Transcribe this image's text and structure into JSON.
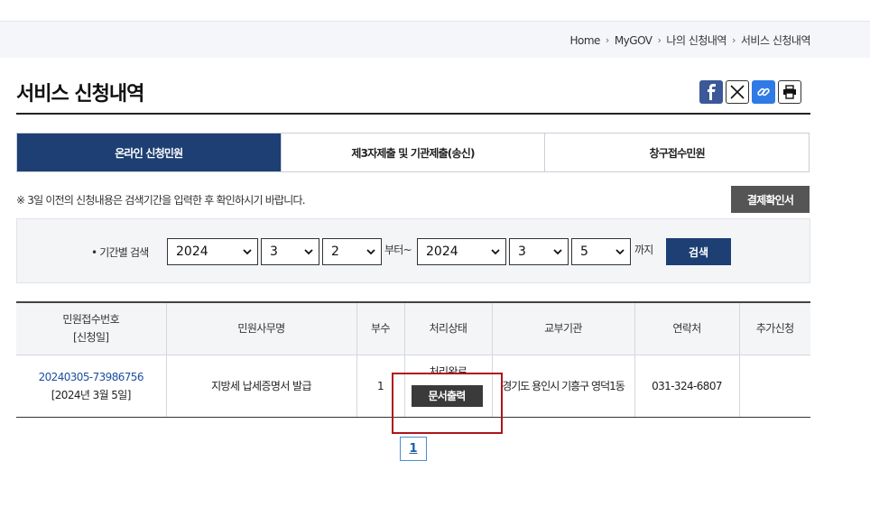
{
  "breadcrumb": {
    "items": [
      "Home",
      "MyGOV",
      "나의 신청내역",
      "서비스 신청내역"
    ]
  },
  "page": {
    "title": "서비스 신청내역"
  },
  "share": {
    "icons": [
      "facebook-icon",
      "x-icon",
      "link-icon",
      "print-icon"
    ],
    "colors": {
      "facebook": "#3b5998",
      "link": "#2f7ae5"
    }
  },
  "tabs": [
    {
      "label": "온라인 신청민원",
      "active": true
    },
    {
      "label": "제3자제출 및 기관제출(송신)",
      "active": false
    },
    {
      "label": "창구접수민원",
      "active": false
    }
  ],
  "notice": "※ 3일 이전의 신청내용은 검색기간을 입력한 후 확인하시기 바랍니다.",
  "receipt_button": "결제확인서",
  "search": {
    "label": "• 기간별 검색",
    "from_year": "2024",
    "from_month": "3",
    "from_day": "2",
    "from_suffix": "부터~",
    "to_year": "2024",
    "to_month": "3",
    "to_day": "5",
    "to_suffix": "까지",
    "button": "검색"
  },
  "table": {
    "headers": {
      "receipt_no": "민원접수번호",
      "receipt_date": "[신청일]",
      "service": "민원사무명",
      "copies": "부수",
      "status": "처리상태",
      "agency": "교부기관",
      "contact": "연락처",
      "extra": "추가신청"
    },
    "rows": [
      {
        "receipt_no": "20240305-73986756",
        "date": "[2024년 3월 5일]",
        "service": "지방세 납세증명서 발급",
        "copies": "1",
        "status": "처리완료",
        "print_button": "문서출력",
        "agency": "경기도 용인시 기흥구 영덕1동",
        "contact": "031-324-6807",
        "extra": ""
      }
    ]
  },
  "pagination": {
    "current": "1"
  },
  "colors": {
    "primary": "#1d3f73",
    "highlight": "#b0141a"
  }
}
